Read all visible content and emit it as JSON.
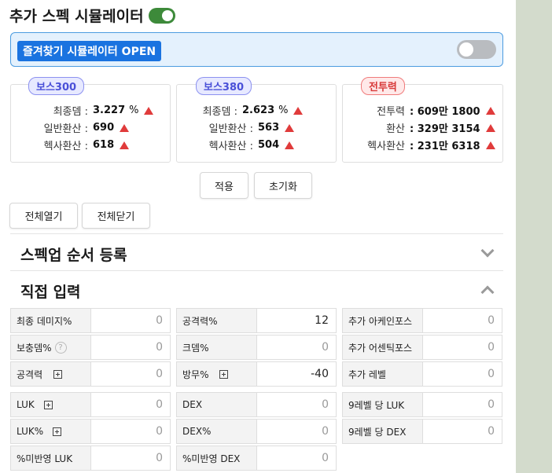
{
  "header": {
    "title": "추가 스펙 시뮬레이터"
  },
  "favorites": {
    "label": "즐겨찾기 시뮬레이터 OPEN"
  },
  "cards": [
    {
      "badge": "보스300",
      "rows": [
        {
          "label": "최종뎀 :",
          "value": "3.227",
          "unit": "%"
        },
        {
          "label": "일반환산 :",
          "value": "690",
          "unit": ""
        },
        {
          "label": "헥사환산 :",
          "value": "618",
          "unit": ""
        }
      ]
    },
    {
      "badge": "보스380",
      "rows": [
        {
          "label": "최종뎀 :",
          "value": "2.623",
          "unit": "%"
        },
        {
          "label": "일반환산 :",
          "value": "563",
          "unit": ""
        },
        {
          "label": "헥사환산 :",
          "value": "504",
          "unit": ""
        }
      ]
    },
    {
      "badge": "전투력",
      "rows": [
        {
          "label": "전투력",
          "value": ": 609만 1800",
          "unit": ""
        },
        {
          "label": "환산",
          "value": ": 329만 3154",
          "unit": ""
        },
        {
          "label": "헥사환산",
          "value": ": 231만 6318",
          "unit": ""
        }
      ]
    }
  ],
  "buttons": {
    "apply": "적용",
    "reset": "초기화",
    "expand_all": "전체열기",
    "collapse_all": "전체닫기"
  },
  "sections": {
    "order": "스펙업 순서 등록",
    "direct": "직접 입력"
  },
  "inputs": [
    {
      "label": "최종 데미지%",
      "value": "0"
    },
    {
      "label": "공격력%",
      "value": "12"
    },
    {
      "label": "추가 아케인포스",
      "value": "0"
    },
    {
      "label": "보충뎀%",
      "value": "0"
    },
    {
      "label": "크뎀%",
      "value": "0"
    },
    {
      "label": "추가 어센틱포스",
      "value": "0"
    },
    {
      "label": "공격력",
      "value": "0"
    },
    {
      "label": "방무%",
      "value": "-40"
    },
    {
      "label": "추가 레벨",
      "value": "0"
    },
    {
      "label": "LUK",
      "value": "0"
    },
    {
      "label": "DEX",
      "value": "0"
    },
    {
      "label": "9레벨 당 LUK",
      "value": "0"
    },
    {
      "label": "LUK%",
      "value": "0"
    },
    {
      "label": "DEX%",
      "value": "0"
    },
    {
      "label": "9레벨 당 DEX",
      "value": "0"
    },
    {
      "label": "%미반영 LUK",
      "value": "0"
    },
    {
      "label": "%미반영 DEX",
      "value": "0"
    }
  ],
  "help_glyph": "?",
  "colors": {
    "accent_blue": "#1a73e0",
    "toggle_on": "#3d8a3a",
    "increase_arrow": "#e03b3b"
  }
}
